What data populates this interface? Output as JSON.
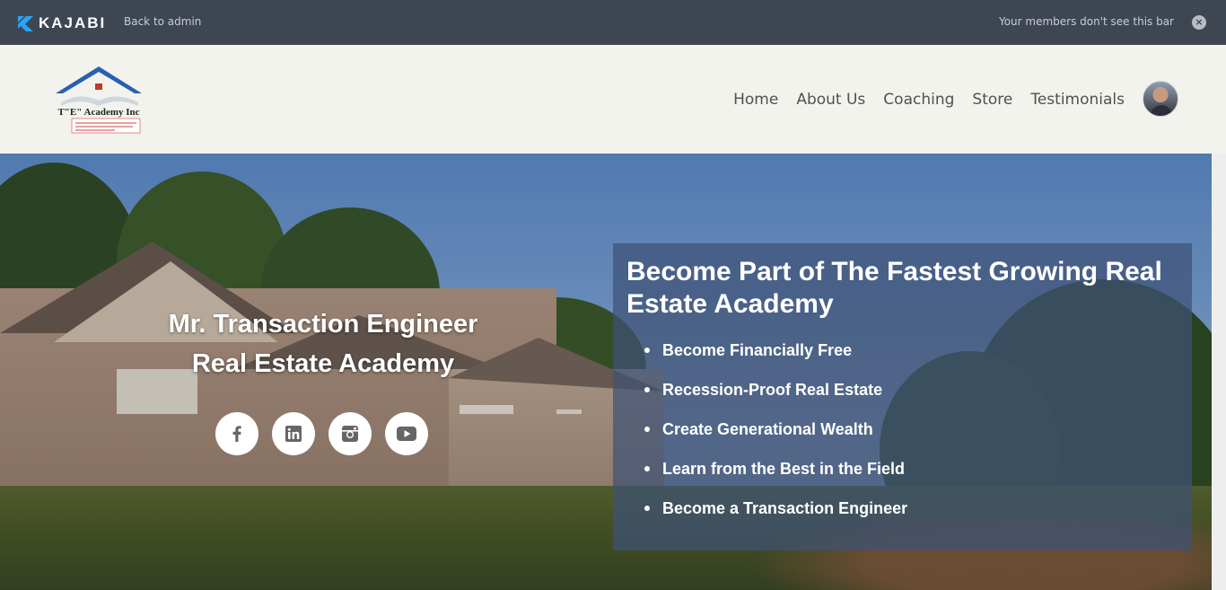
{
  "admin_bar": {
    "brand": "KAJABI",
    "back_label": "Back to admin",
    "notice": "Your members don't see this bar",
    "close_icon": "close-icon"
  },
  "header": {
    "logo_name": "T\"E\" Academy Inc",
    "logo_tagline": "Wisdom is supreme; in all thy getting get understanding",
    "nav": [
      "Home",
      "About Us",
      "Coaching",
      "Store",
      "Testimonials"
    ],
    "avatar": "user-avatar"
  },
  "hero": {
    "title_line1": "Mr. Transaction Engineer",
    "title_line2": "Real Estate Academy",
    "socials": [
      "facebook-icon",
      "linkedin-icon",
      "instagram-icon",
      "youtube-icon"
    ],
    "panel_title": "Become Part of The Fastest Growing Real Estate Academy",
    "bullets": [
      "Become Financially Free",
      "Recession-Proof Real Estate",
      "Create Generational Wealth",
      "Learn from the Best in the Field",
      "Become a Transaction Engineer"
    ]
  },
  "colors": {
    "admin_bar_bg": "#3e4652",
    "header_bg": "#f3f3ee",
    "panel_bg": "#3e5276",
    "kajabi_blue": "#2aa4f4"
  }
}
